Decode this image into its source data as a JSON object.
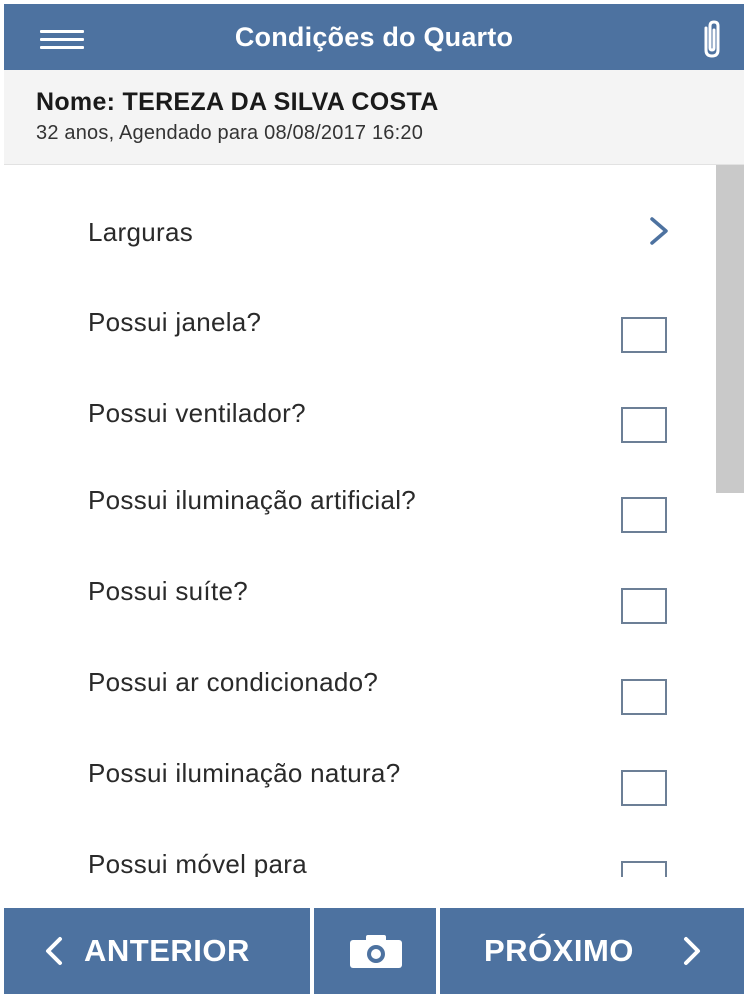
{
  "header": {
    "title": "Condições do Quarto",
    "menu_icon": "hamburger-menu-icon",
    "attach_icon": "paperclip-icon"
  },
  "patient": {
    "name": "Nome: TEREZA DA SILVA COSTA",
    "details": "32 anos, Agendado para 08/08/2017 16:20"
  },
  "list": {
    "nav_item": {
      "label": "Larguras",
      "icon": "chevron-right-icon"
    },
    "questions": [
      {
        "label": "Possui janela?",
        "checked": false
      },
      {
        "label": "Possui ventilador?",
        "checked": false
      },
      {
        "label": "Possui iluminação artificial?",
        "checked": false
      },
      {
        "label": "Possui suíte?",
        "checked": false
      },
      {
        "label": "Possui ar condicionado?",
        "checked": false
      },
      {
        "label": "Possui iluminação natura?",
        "checked": false
      },
      {
        "label": "Possui móvel para",
        "checked": false
      }
    ]
  },
  "footer": {
    "prev_label": "ANTERIOR",
    "camera_icon": "camera-icon",
    "next_label": "PRÓXIMO"
  },
  "colors": {
    "primary": "#4d72a0",
    "checkbox_border": "#6c7f96",
    "header_bg": "#f4f4f4",
    "scroll_thumb": "#c9c9c9"
  }
}
